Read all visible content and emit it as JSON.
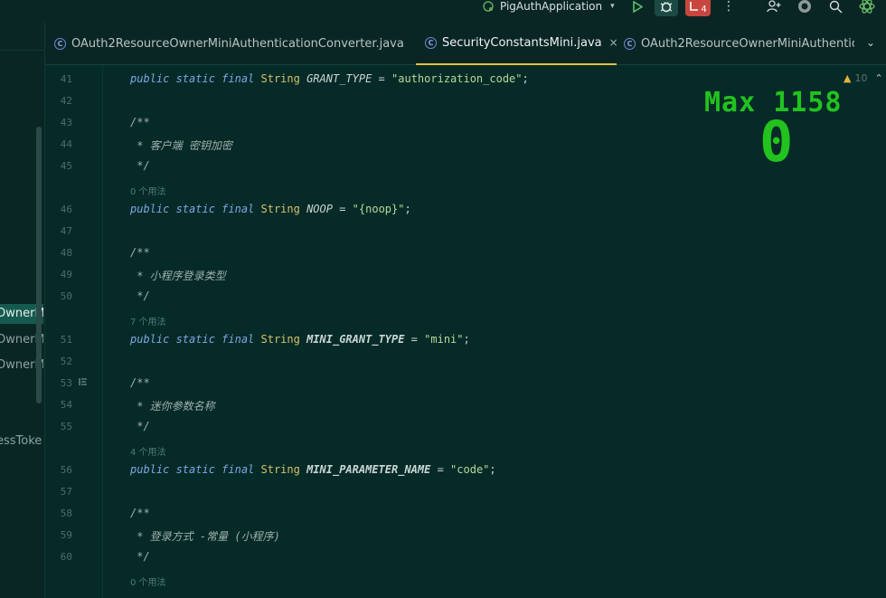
{
  "toolbar": {
    "run_config": "PigAuthApplication",
    "stop_badge": "4",
    "more": "⋮"
  },
  "project_tree": {
    "items": [
      {
        "label": "OwnerMi",
        "selected": true
      },
      {
        "label": "OwnerMi",
        "selected": false
      },
      {
        "label": "OwnerMi",
        "selected": false
      },
      {
        "label": "essToke",
        "selected": false
      }
    ]
  },
  "tabs": [
    {
      "label": "OAuth2ResourceOwnerMiniAuthenticationConverter.java",
      "active": false,
      "icon": "class-icon"
    },
    {
      "label": "SecurityConstantsMini.java",
      "active": true,
      "icon": "class-icon",
      "close": "×"
    },
    {
      "label": "OAuth2ResourceOwnerMiniAuthentic",
      "active": false,
      "icon": "class-icon"
    }
  ],
  "editor": {
    "warning_count": "10",
    "lines": [
      {
        "n": "41",
        "kind": "decl",
        "name": "GRANT_TYPE",
        "value": "\"authorization_code\"",
        "bold": false
      },
      {
        "n": "42",
        "kind": "blank"
      },
      {
        "n": "43",
        "kind": "comment",
        "text": "/**"
      },
      {
        "n": "44",
        "kind": "comment",
        "text": " * 客户端 密钥加密"
      },
      {
        "n": "45",
        "kind": "comment",
        "text": " */"
      },
      {
        "kind": "hint",
        "text": "0 个用法"
      },
      {
        "n": "46",
        "kind": "decl",
        "name": "NOOP",
        "value": "\"{noop}\"",
        "bold": false
      },
      {
        "n": "47",
        "kind": "blank"
      },
      {
        "n": "48",
        "kind": "comment",
        "text": "/**"
      },
      {
        "n": "49",
        "kind": "comment",
        "text": " * 小程序登录类型"
      },
      {
        "n": "50",
        "kind": "comment",
        "text": " */"
      },
      {
        "kind": "hint",
        "text": "7 个用法"
      },
      {
        "n": "51",
        "kind": "decl",
        "name": "MINI_GRANT_TYPE",
        "value": "\"mini\"",
        "bold": true
      },
      {
        "n": "52",
        "kind": "blank"
      },
      {
        "n": "53",
        "kind": "comment",
        "text": "/**"
      },
      {
        "n": "54",
        "kind": "comment",
        "text": " * 迷你参数名称"
      },
      {
        "n": "55",
        "kind": "comment",
        "text": " */"
      },
      {
        "kind": "hint",
        "text": "4 个用法"
      },
      {
        "n": "56",
        "kind": "decl",
        "name": "MINI_PARAMETER_NAME",
        "value": "\"code\"",
        "bold": true
      },
      {
        "n": "57",
        "kind": "blank"
      },
      {
        "n": "58",
        "kind": "comment",
        "text": "/**"
      },
      {
        "n": "59",
        "kind": "comment",
        "text": " * 登录方式 -常量 (小程序)"
      },
      {
        "n": "60",
        "kind": "comment",
        "text": " */"
      },
      {
        "kind": "hint",
        "text": "0 个用法"
      }
    ]
  },
  "overlay": {
    "max_label": "Max",
    "max_value": "1158",
    "score": "0"
  },
  "colors": {
    "background": "#062a27",
    "keyword": "#7fa6e4",
    "type": "#d3c36b",
    "string": "#b6d99a",
    "overlay_green": "#22c21f",
    "active_tab_underline": "#e0c03c"
  }
}
